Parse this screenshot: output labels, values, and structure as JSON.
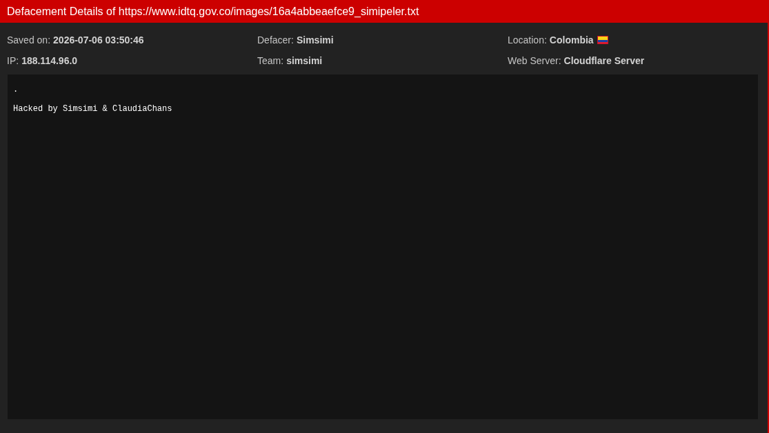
{
  "header": {
    "title": "Defacement Details of https://www.idtq.gov.co/images/16a4abbeaefce9_simipeler.txt"
  },
  "details": [
    {
      "kind": "text",
      "label": "Saved on:",
      "value": "2026-07-06 03:50:46"
    },
    {
      "kind": "text",
      "label": "Defacer:",
      "value": "Simsimi"
    },
    {
      "kind": "country",
      "label": "Location:",
      "value": "Colombia"
    },
    {
      "kind": "text",
      "label": "IP:",
      "value": "188.114.96.0"
    },
    {
      "kind": "text",
      "label": "Team:",
      "value": "simsimi"
    },
    {
      "kind": "text",
      "label": "Web Server:",
      "value": "Cloudflare Server"
    }
  ],
  "content": {
    "text": ".\n\nHacked by Simsimi & ClaudiaChans"
  }
}
